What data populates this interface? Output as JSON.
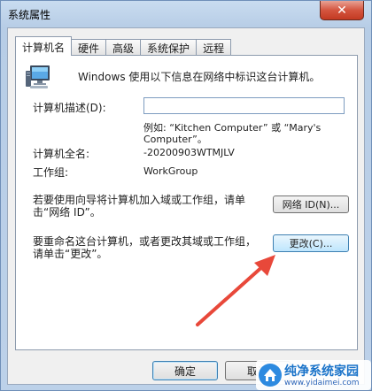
{
  "window": {
    "title": "系统属性"
  },
  "tabs": [
    {
      "label": "计算机名",
      "active": true
    },
    {
      "label": "硬件",
      "active": false
    },
    {
      "label": "高级",
      "active": false
    },
    {
      "label": "系统保护",
      "active": false
    },
    {
      "label": "远程",
      "active": false
    }
  ],
  "computer_name": {
    "intro": "Windows 使用以下信息在网络中标识这台计算机。",
    "description_label": "计算机描述(D):",
    "description_value": "",
    "example_line1": "例如: “Kitchen Computer” 或 “Mary's",
    "example_line2": "Computer”。",
    "full_name_label": "计算机全名:",
    "full_name_value": "-20200903WTMJLV",
    "workgroup_label": "工作组:",
    "workgroup_value": "WorkGroup",
    "network_id_text_line1": "若要使用向导将计算机加入域或工作组，请单",
    "network_id_text_line2": "击“网络 ID”。",
    "network_id_button": "网络 ID(N)...",
    "rename_text_line1": "要重命名这台计算机，或者更改其域或工作组，",
    "rename_text_line2": "请单击“更改”。",
    "change_button": "更改(C)..."
  },
  "buttons": {
    "ok": "确定",
    "cancel": "取消"
  },
  "watermark": {
    "title": "纯净系统家园",
    "url": "www.yidaimei.com"
  },
  "colors": {
    "annotation_arrow": "#e8483a",
    "accent_border": "#3c7fb1"
  }
}
